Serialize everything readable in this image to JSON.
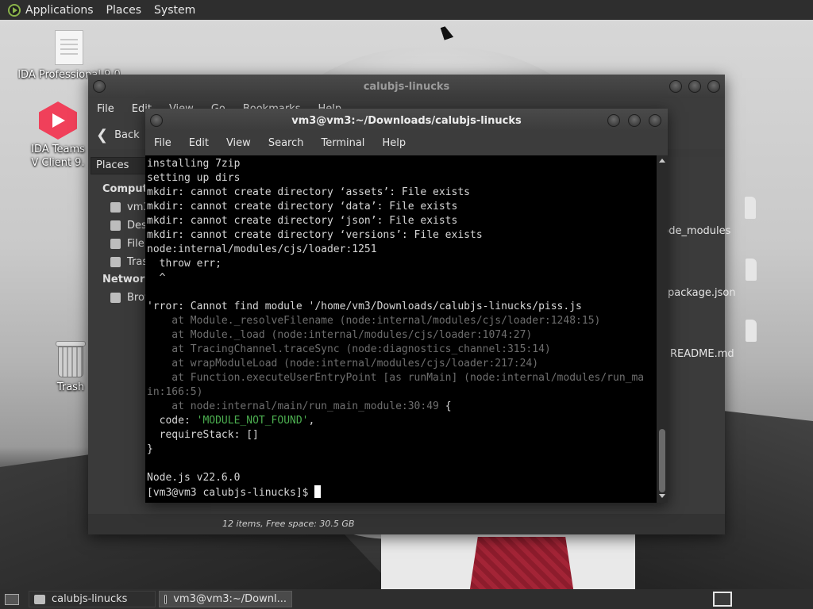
{
  "top_panel": {
    "menus": [
      "Applications",
      "Places",
      "System"
    ]
  },
  "desktop": {
    "icons": [
      {
        "label": "IDA Professional 9.0"
      },
      {
        "label": "IDA Teams V Client 9."
      },
      {
        "label": "Trash"
      }
    ]
  },
  "file_manager": {
    "title": "calubjs-linucks",
    "menu": [
      "File",
      "Edit",
      "View",
      "Go",
      "Bookmarks",
      "Help"
    ],
    "back_label": "Back",
    "places_label": "Places",
    "sidebar": {
      "computer_heading": "Computer",
      "computer_items": [
        "vm3",
        "Desktop",
        "File System",
        "Trash"
      ],
      "network_heading": "Network",
      "network_items": [
        "Browse Network"
      ]
    },
    "files": [
      "node_modules",
      "package.json",
      "README.md"
    ],
    "status": "12 items, Free space: 30.5 GB"
  },
  "terminal": {
    "title": "vm3@vm3:~/Downloads/calubjs-linucks",
    "menu": [
      "File",
      "Edit",
      "View",
      "Search",
      "Terminal",
      "Help"
    ],
    "lines": [
      "installing 7zip",
      "setting up dirs",
      "mkdir: cannot create directory ‘assets’: File exists",
      "mkdir: cannot create directory ‘data’: File exists",
      "mkdir: cannot create directory ‘json’: File exists",
      "mkdir: cannot create directory ‘versions’: File exists",
      "node:internal/modules/cjs/loader:1251",
      "  throw err;",
      "  ^",
      "",
      "'rror: Cannot find module '/home/vm3/Downloads/calubjs-linucks/piss.js",
      "    at Module._resolveFilename (node:internal/modules/cjs/loader:1248:15)",
      "    at Module._load (node:internal/modules/cjs/loader:1074:27)",
      "    at TracingChannel.traceSync (node:diagnostics_channel:315:14)",
      "    at wrapModuleLoad (node:internal/modules/cjs/loader:217:24)",
      "    at Function.executeUserEntryPoint [as runMain] (node:internal/modules/run_ma",
      "in:166:5)",
      "    at node:internal/main/run_main_module:30:49 {",
      "  code: 'MODULE_NOT_FOUND',",
      "  requireStack: []",
      "}",
      "",
      "Node.js v22.6.0",
      "[vm3@vm3 calubjs-linucks]$ "
    ],
    "dim_from": 11,
    "dim_to": 17
  },
  "taskbar": {
    "tasks": [
      "calubjs-linucks",
      "vm3@vm3:~/Downl..."
    ]
  },
  "colors": {
    "panel_bg": "#2e2e2e",
    "terminal_bg": "#000000",
    "string_green": "#4caf50"
  }
}
